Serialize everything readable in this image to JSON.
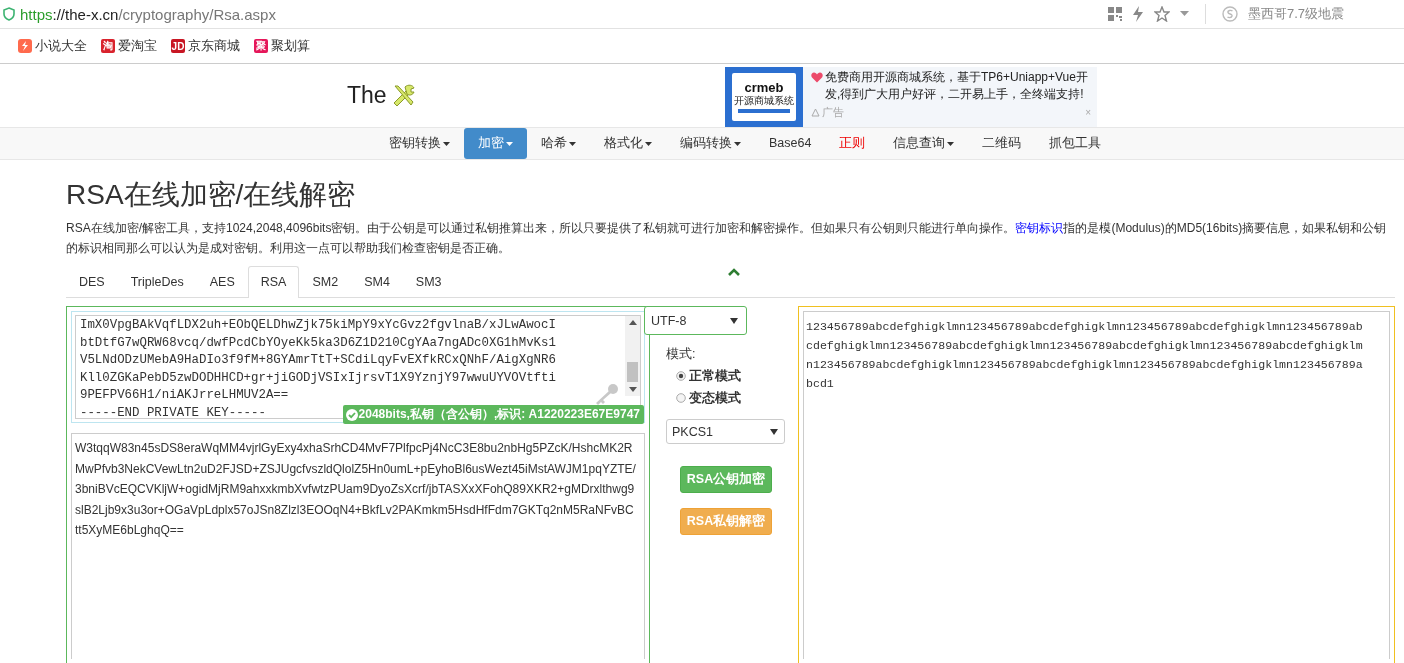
{
  "browser": {
    "url": {
      "scheme": "https",
      "host": "://the-x.cn",
      "path": "/cryptography/Rsa.aspx"
    },
    "search_hint": "墨西哥7.7级地震",
    "bookmarks": [
      {
        "kind": "drawn",
        "label": "小说大全"
      },
      {
        "kind": "glyph",
        "icon_text": "淘",
        "label": "爱淘宝",
        "color": "#d9232d"
      },
      {
        "kind": "glyph",
        "icon_text": "JD",
        "label": "京东商城",
        "color": "#c81623"
      },
      {
        "kind": "glyph",
        "icon_text": "聚",
        "label": "聚划算",
        "color": "#e5175a"
      }
    ]
  },
  "header": {
    "logo_text": "The",
    "ad": {
      "brand": "crmeb",
      "brand_tagline": "开源商城系统",
      "text": "免费商用开源商城系统，基于TP6+Uniapp+Vue开发,得到广大用户好评，二开易上手，全终端支持!",
      "label": "广告",
      "close": "×"
    }
  },
  "nav": [
    {
      "label": "密钥转换",
      "dropdown": true,
      "selected": false,
      "hot": false
    },
    {
      "label": "加密",
      "dropdown": true,
      "selected": true,
      "hot": false
    },
    {
      "label": "哈希",
      "dropdown": true,
      "selected": false,
      "hot": false
    },
    {
      "label": "格式化",
      "dropdown": true,
      "selected": false,
      "hot": false
    },
    {
      "label": "编码转换",
      "dropdown": true,
      "selected": false,
      "hot": false
    },
    {
      "label": "Base64",
      "dropdown": false,
      "selected": false,
      "hot": false
    },
    {
      "label": "正则",
      "dropdown": false,
      "selected": false,
      "hot": true
    },
    {
      "label": "信息查询",
      "dropdown": true,
      "selected": false,
      "hot": false
    },
    {
      "label": "二维码",
      "dropdown": false,
      "selected": false,
      "hot": false
    },
    {
      "label": "抓包工具",
      "dropdown": false,
      "selected": false,
      "hot": false
    }
  ],
  "page": {
    "title": "RSA在线加密/在线解密",
    "description": {
      "before": "RSA在线加密/解密工具，支持1024,2048,4096bits密钥。由于公钥是可以通过私钥推算出来，所以只要提供了私钥就可进行加密和解密操作。但如果只有公钥则只能进行单向操作。",
      "link": "密钥标识",
      "after": "指的是模(Modulus)的MD5(16bits)摘要信息，如果私钥和公钥的标识相同那么可以认为是成对密钥。利用这一点可以帮助我们检查密钥是否正确。"
    }
  },
  "tabs": [
    {
      "label": "DES",
      "selected": false
    },
    {
      "label": "TripleDes",
      "selected": false
    },
    {
      "label": "AES",
      "selected": false
    },
    {
      "label": "RSA",
      "selected": true
    },
    {
      "label": "SM2",
      "selected": false
    },
    {
      "label": "SM4",
      "selected": false
    },
    {
      "label": "SM3",
      "selected": false
    }
  ],
  "key_box": {
    "lines": [
      "ImX0VpgBAkVqfLDX2uh+EObQELDhwZjk75kiMpY9xYcGvz2fgvlnaB/xJLwAwocI",
      "btDtfG7wQRW68vcq/dwfPcdCbYOyeKk5ka3D6Z1D210CgYAa7ngADc0XG1hMvKs1",
      "V5LNdODzUMebA9HaDIo3f9fM+8GYAmrTtT+SCdiLqyFvEXfkRCxQNhF/AigXgNR6",
      "Kll0ZGKaPebD5zwDODHHCD+gr+jiGODjVSIxIjrsvT1X9YznjY97wwuUYVOVtfti",
      "9PEFPV66H1/niAKJrreLHMUV2A==",
      "-----END PRIVATE KEY-----"
    ],
    "badge": "2048bits,私钥（含公钥）,标识: A1220223E67E9747"
  },
  "cipher_box": {
    "lines": [
      "W3tqqW83n45sDS8eraWqMM4vjrlGyExy4xhaSrhCD4MvF7PlfpcPj4NcC3E8bu2nbHg5PZcK/HshcMK2R",
      "MwPfvb3NekCVewLtn2uD2FJSD+ZSJUgcfvszldQlolZ5Hn0umL+pEyhoBl6usWezt45iMstAWJM1pqYZTE/",
      "3bniBVcEQCVKljW+ogidMjRM9ahxxkmbXvfwtzPUam9DyoZsXcrf/jbTASXxXFohQ89XKR2+gMDrxlthwg9",
      "slB2Ljb9x3u3or+OGaVpLdplx57oJSn8Zlzl3EOOqN4+BkfLv2PAKmkm5HsdHfFdm7GKTq2nM5RaNFvBC",
      "tt5XyME6bLghqQ=="
    ]
  },
  "controls": {
    "encoding": "UTF-8",
    "mode_label": "模式:",
    "modes": [
      {
        "label": "正常模式",
        "selected": true
      },
      {
        "label": "变态模式",
        "selected": false
      }
    ],
    "padding": "PKCS1",
    "buttons": [
      {
        "label": "RSA公钥加密",
        "kind": "success"
      },
      {
        "label": "RSA私钥解密",
        "kind": "warning"
      }
    ]
  },
  "plain_box": {
    "lines": [
      "123456789abcdefghigklmn123456789abcdefghigklmn123456789abcdefghigklmn123456789ab",
      "cdefghigklmn123456789abcdefghigklmn123456789abcdefghigklmn123456789abcdefghigklm",
      "n123456789abcdefghigklmn123456789abcdefghigklmn123456789abcdefghigklmn123456789a",
      "bcd1"
    ]
  }
}
